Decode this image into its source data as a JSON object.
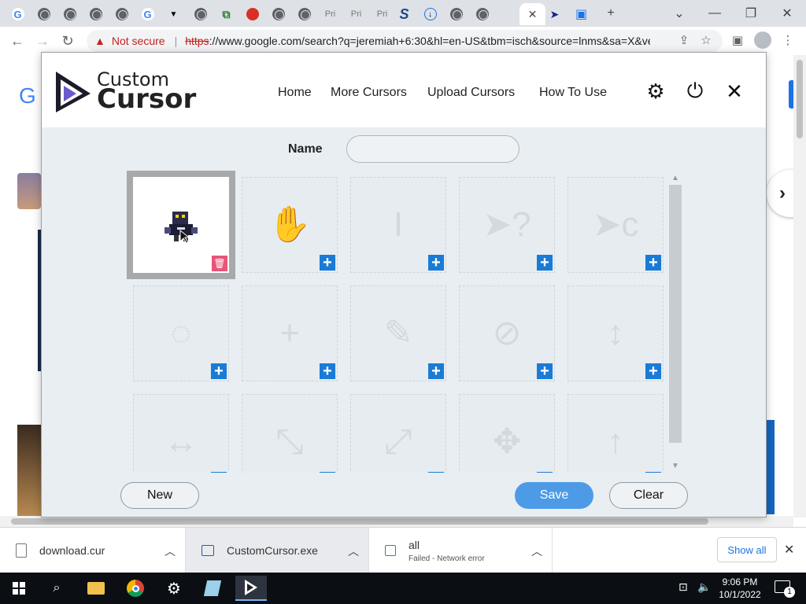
{
  "browser": {
    "tabs": [
      {
        "icon": "google-icon",
        "glyph": "G"
      },
      {
        "icon": "globe-icon",
        "glyph": ""
      },
      {
        "icon": "globe-icon",
        "glyph": ""
      },
      {
        "icon": "globe-icon",
        "glyph": ""
      },
      {
        "icon": "globe-icon",
        "glyph": ""
      },
      {
        "icon": "google-icon",
        "glyph": "G"
      },
      {
        "icon": "shield-icon",
        "glyph": "▼"
      },
      {
        "icon": "globe-icon",
        "glyph": ""
      },
      {
        "icon": "puzzle-icon",
        "glyph": "⧉"
      },
      {
        "icon": "red-circle-icon",
        "glyph": ""
      },
      {
        "icon": "globe-icon",
        "glyph": ""
      },
      {
        "icon": "globe-icon",
        "glyph": ""
      },
      {
        "icon": "private-icon",
        "glyph": "Pri"
      },
      {
        "icon": "private-icon",
        "glyph": "Pri"
      },
      {
        "icon": "private-icon",
        "glyph": "Pri"
      },
      {
        "icon": "s-logo-icon",
        "glyph": "S"
      },
      {
        "icon": "cloud-download-icon",
        "glyph": "↓"
      },
      {
        "icon": "globe-icon",
        "glyph": ""
      },
      {
        "icon": "globe-icon",
        "glyph": ""
      },
      {
        "icon": "globe-icon",
        "glyph": ""
      },
      {
        "icon": "close-icon",
        "glyph": "✕"
      },
      {
        "icon": "cursor-icon",
        "glyph": "➤"
      },
      {
        "icon": "image-icon",
        "glyph": "▣"
      }
    ],
    "new_tab_glyph": "+",
    "address": {
      "warning_label": "Not secure",
      "scheme": "https",
      "rest": "://www.google.com/search?q=jeremiah+6:30&hl=en-US&tbm=isch&source=lnms&sa=X&ve..."
    }
  },
  "popup": {
    "logo": {
      "line1": "Custom",
      "line2": "Cursor"
    },
    "nav": [
      "Home",
      "More Cursors",
      "Upload Cursors",
      "How To Use"
    ],
    "name_label": "Name",
    "name_value": "",
    "cells": [
      {
        "glyph": "",
        "selected": true
      },
      {
        "glyph": "✋"
      },
      {
        "glyph": "I"
      },
      {
        "glyph": "➤?"
      },
      {
        "glyph": "➤c"
      },
      {
        "glyph": "◌"
      },
      {
        "glyph": "+"
      },
      {
        "glyph": "✎"
      },
      {
        "glyph": "⊘"
      },
      {
        "glyph": "↕"
      },
      {
        "glyph": "↔"
      },
      {
        "glyph": "⤡"
      },
      {
        "glyph": "⤢"
      },
      {
        "glyph": "✥"
      },
      {
        "glyph": "↑"
      }
    ],
    "buttons": {
      "new": "New",
      "save": "Save",
      "clear": "Clear"
    }
  },
  "downloads": [
    {
      "name": "download.cur",
      "status": ""
    },
    {
      "name": "CustomCursor.exe",
      "status": ""
    },
    {
      "name": "all",
      "status": "Failed - Network error"
    }
  ],
  "show_all": "Show all",
  "taskbar": {
    "time": "9:06 PM",
    "date": "10/1/2022",
    "notifications": "1"
  },
  "colors": {
    "primary": "#4d9be6",
    "add": "#1a7bd6",
    "delete": "#e9557a"
  }
}
